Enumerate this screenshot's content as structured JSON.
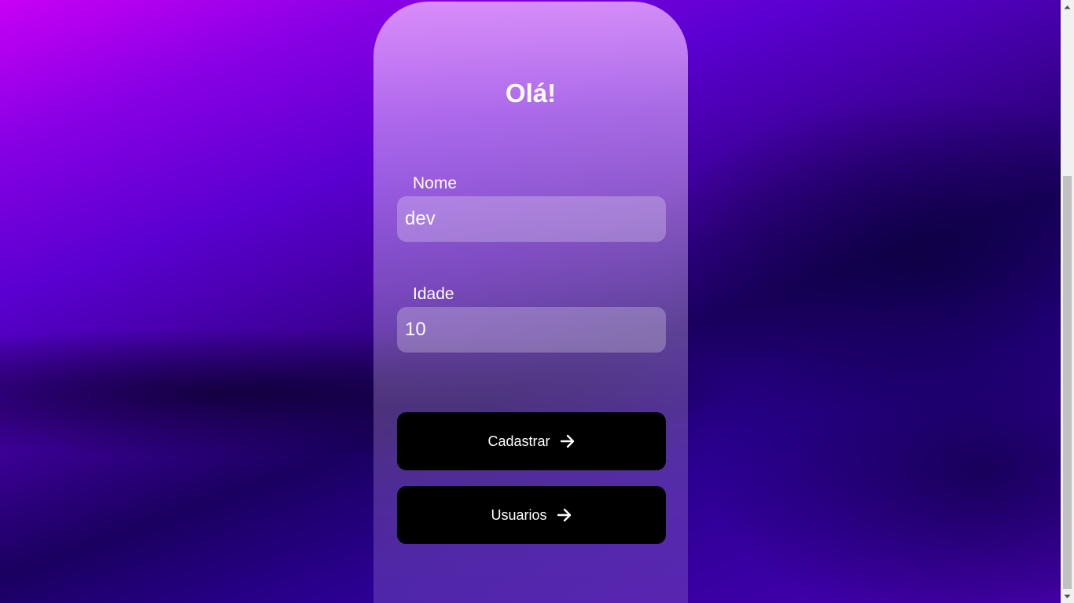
{
  "form": {
    "title": "Olá!",
    "nome_label": "Nome",
    "nome_value": "dev",
    "idade_label": "Idade",
    "idade_value": "10"
  },
  "buttons": {
    "cadastrar_label": "Cadastrar",
    "usuarios_label": "Usuarios",
    "icon": "arrow-right-icon"
  },
  "colors": {
    "background_top": "#c800f5",
    "background_dark": "#1a0060",
    "button": "#000000",
    "text": "#ffffff"
  }
}
